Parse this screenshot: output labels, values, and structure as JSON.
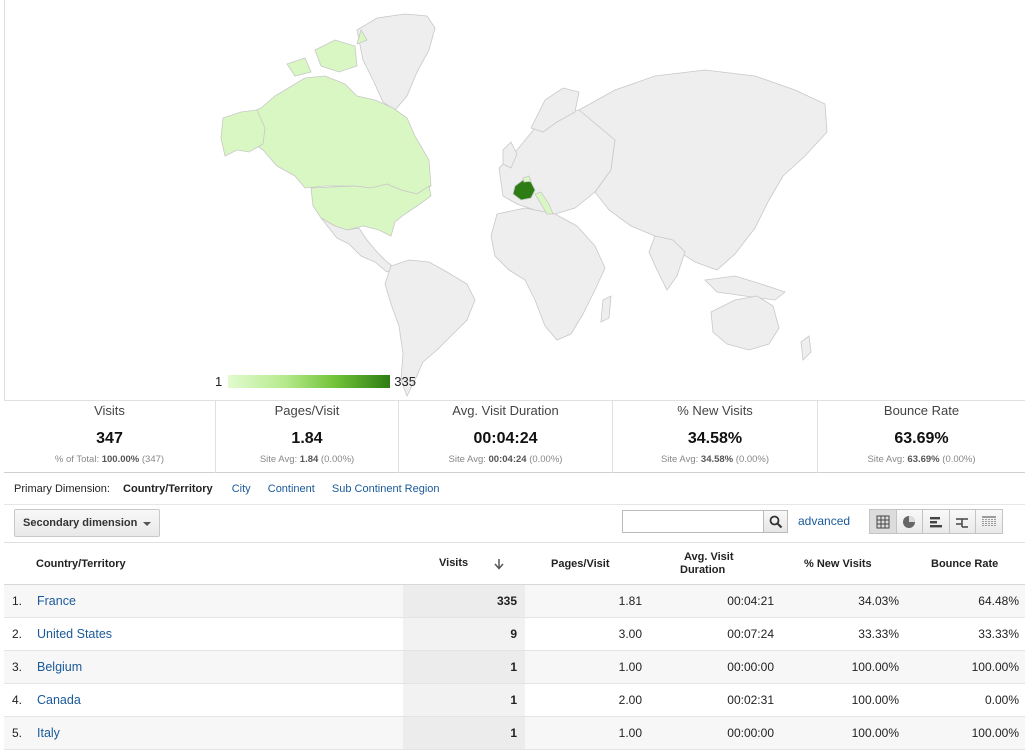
{
  "legend": {
    "min": "1",
    "max": "335"
  },
  "map_data": {
    "France": 335,
    "United States": 9,
    "Belgium": 1,
    "Canada": 1,
    "Italy": 1,
    "colors": {
      "max": "#2d7d14",
      "low": "#d9f7c2",
      "none": "#eeeeee",
      "border": "#c8c8c8"
    }
  },
  "metrics": [
    {
      "label": "Visits",
      "value": "347",
      "sub_prefix": "% of Total:",
      "sub_bold": "100.00%",
      "sub_suffix": "(347)"
    },
    {
      "label": "Pages/Visit",
      "value": "1.84",
      "sub_prefix": "Site Avg:",
      "sub_bold": "1.84",
      "sub_suffix": "(0.00%)"
    },
    {
      "label": "Avg. Visit Duration",
      "value": "00:04:24",
      "sub_prefix": "Site Avg:",
      "sub_bold": "00:04:24",
      "sub_suffix": "(0.00%)"
    },
    {
      "label": "% New Visits",
      "value": "34.58%",
      "sub_prefix": "Site Avg:",
      "sub_bold": "34.58%",
      "sub_suffix": "(0.00%)"
    },
    {
      "label": "Bounce Rate",
      "value": "63.69%",
      "sub_prefix": "Site Avg:",
      "sub_bold": "63.69%",
      "sub_suffix": "(0.00%)"
    }
  ],
  "primary_dimension": {
    "label": "Primary Dimension:",
    "active": "Country/Territory",
    "options": [
      "City",
      "Continent",
      "Sub Continent Region"
    ]
  },
  "toolbar": {
    "secondary_dimension": "Secondary dimension",
    "search_value": "",
    "advanced": "advanced"
  },
  "table": {
    "headers": {
      "country": "Country/Territory",
      "visits": "Visits",
      "pages": "Pages/Visit",
      "duration_line1": "Avg. Visit",
      "duration_line2": "Duration",
      "new_visits": "% New Visits",
      "bounce": "Bounce Rate"
    },
    "rows": [
      {
        "rank": "1.",
        "country": "France",
        "visits": "335",
        "pages": "1.81",
        "duration": "00:04:21",
        "new_visits": "34.03%",
        "bounce": "64.48%"
      },
      {
        "rank": "2.",
        "country": "United States",
        "visits": "9",
        "pages": "3.00",
        "duration": "00:07:24",
        "new_visits": "33.33%",
        "bounce": "33.33%"
      },
      {
        "rank": "3.",
        "country": "Belgium",
        "visits": "1",
        "pages": "1.00",
        "duration": "00:00:00",
        "new_visits": "100.00%",
        "bounce": "100.00%"
      },
      {
        "rank": "4.",
        "country": "Canada",
        "visits": "1",
        "pages": "2.00",
        "duration": "00:02:31",
        "new_visits": "100.00%",
        "bounce": "0.00%"
      },
      {
        "rank": "5.",
        "country": "Italy",
        "visits": "1",
        "pages": "1.00",
        "duration": "00:00:00",
        "new_visits": "100.00%",
        "bounce": "100.00%"
      }
    ]
  }
}
